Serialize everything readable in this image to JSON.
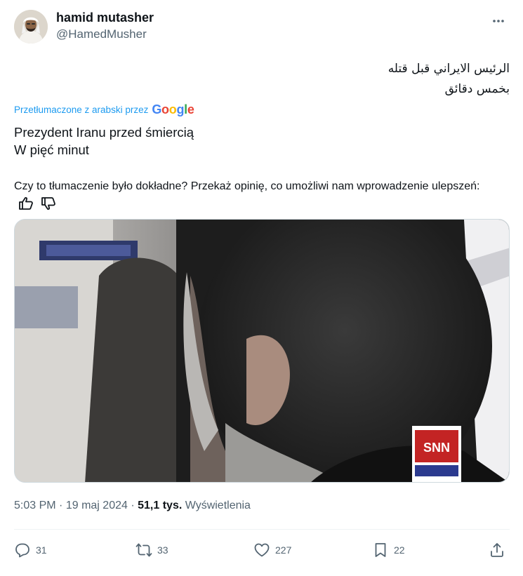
{
  "author": {
    "display_name": "hamid mutasher",
    "handle": "@HamedMusher"
  },
  "tweet": {
    "original_lines": [
      "الرئيس الايراني قبل قتله",
      "بخمس دقائق"
    ],
    "translated_by_label": "Przetłumaczone z arabski przez",
    "translated_by_brand": "Google",
    "translation_lines": [
      "Prezydent Iranu przed śmiercią",
      "W pięć minut"
    ],
    "feedback_text": "Czy to tłumaczenie było dokładne? Przekaż opinię, co umożliwi nam wprowadzenie ulepszeń:"
  },
  "media": {
    "watermark": "SNN"
  },
  "meta": {
    "time": "5:03 PM",
    "date": "19 maj 2024",
    "views_count": "51,1 tys.",
    "views_label": "Wyświetlenia"
  },
  "actions": {
    "replies": "31",
    "reposts": "33",
    "likes": "227",
    "bookmarks": "22"
  },
  "icons": {
    "more": "more-dots-icon",
    "thumbs_up": "thumbs-up-icon",
    "thumbs_down": "thumbs-down-icon",
    "reply": "reply-icon",
    "repost": "repost-icon",
    "like": "heart-icon",
    "bookmark": "bookmark-icon",
    "share": "share-icon"
  },
  "colors": {
    "link": "#1d9bf0",
    "muted": "#536471",
    "text": "#0f1419"
  }
}
